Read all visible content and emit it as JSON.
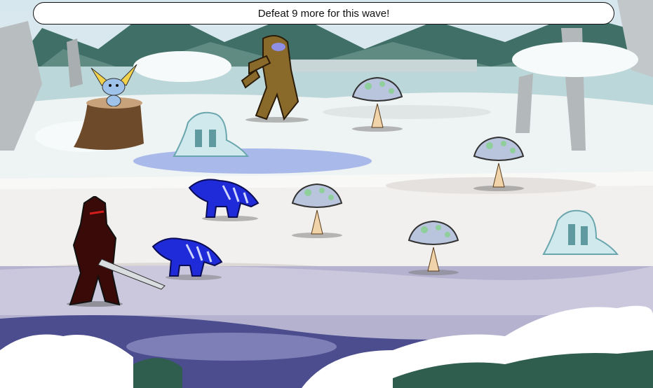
{
  "hud": {
    "wave_message": "Defeat 9 more for this wave!"
  },
  "colors": {
    "sky": "#d7e7ee",
    "snow": "#f4f7f8",
    "ice_water": "#aab8e6",
    "forest": "#2f5d4e",
    "mushroom_cap": "#b9c4dd",
    "mushroom_spots": "#8fcf9b",
    "dragon_blue": "#1f2ad8",
    "slime": "#cfe9ec",
    "mummy": "#8a6a2a",
    "knight": "#3a0a08"
  },
  "entities": {
    "player": {
      "icon": "dark-knight-with-sword"
    },
    "pet": {
      "icon": "blue-moglin-pet"
    },
    "enemies": [
      {
        "type": "mummy"
      },
      {
        "type": "ice-slime"
      },
      {
        "type": "ice-slime"
      },
      {
        "type": "mushroom-creature"
      },
      {
        "type": "mushroom-creature"
      },
      {
        "type": "mushroom-creature"
      },
      {
        "type": "mushroom-creature"
      },
      {
        "type": "blue-lizard"
      },
      {
        "type": "blue-lizard"
      }
    ]
  }
}
